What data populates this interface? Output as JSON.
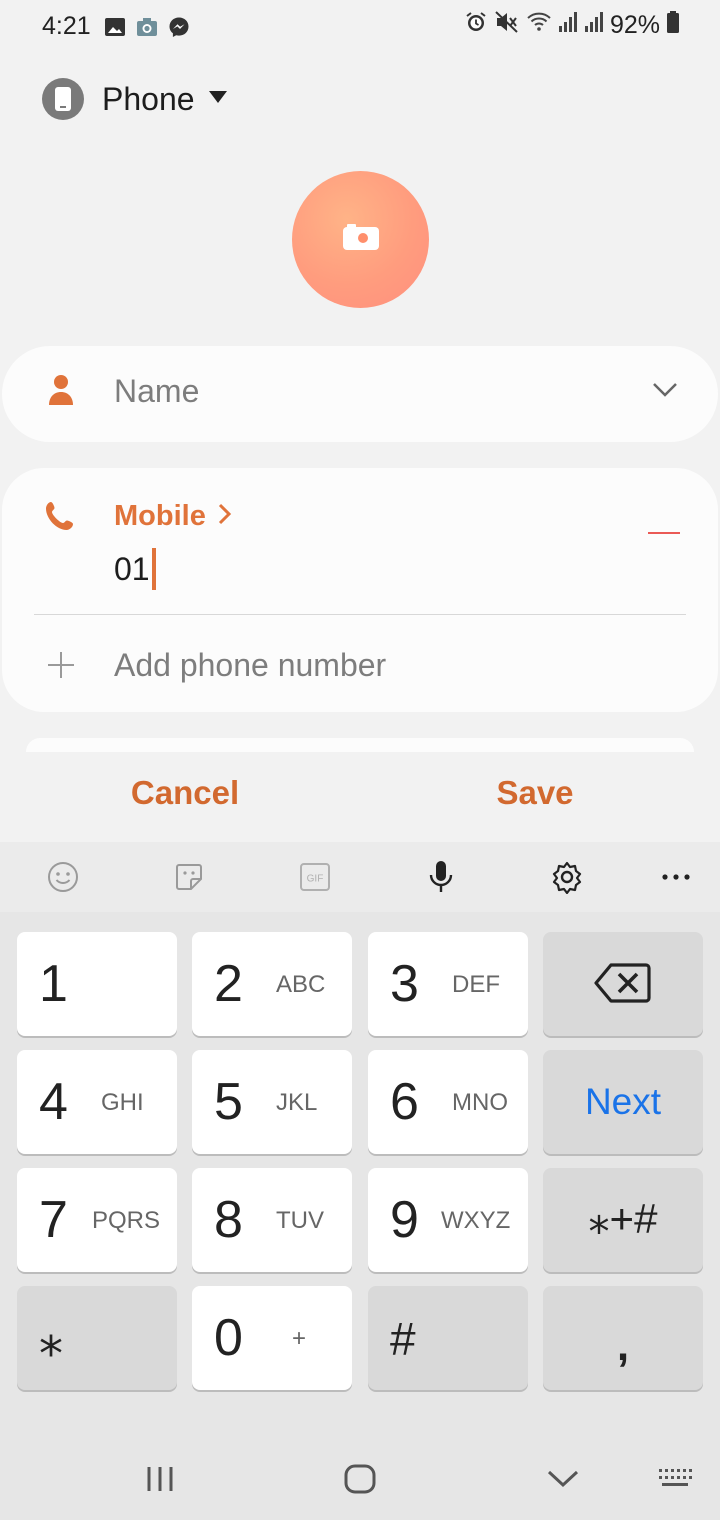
{
  "status_bar": {
    "time": "4:21",
    "battery": "92%",
    "left_icons": [
      "gallery-icon",
      "camera-icon",
      "messenger-icon"
    ],
    "right_icons": [
      "alarm-icon",
      "mute-icon",
      "wifi-icon",
      "signal-icon",
      "signal-icon",
      "battery-icon"
    ]
  },
  "account": {
    "label": "Phone"
  },
  "form": {
    "name_placeholder": "Name",
    "phone_type": "Mobile",
    "phone_value": "01",
    "add_phone_label": "Add phone number"
  },
  "actions": {
    "cancel": "Cancel",
    "save": "Save"
  },
  "keyboard": {
    "toolbar": [
      "emoji-icon",
      "sticker-icon",
      "gif-icon",
      "microphone-icon",
      "settings-icon",
      "more-icon"
    ],
    "gif_label": "GIF",
    "keys": [
      {
        "digit": "1",
        "letters": ""
      },
      {
        "digit": "2",
        "letters": "ABC"
      },
      {
        "digit": "3",
        "letters": "DEF"
      },
      {
        "digit": "4",
        "letters": "GHI"
      },
      {
        "digit": "5",
        "letters": "JKL"
      },
      {
        "digit": "6",
        "letters": "MNO"
      },
      {
        "digit": "7",
        "letters": "PQRS"
      },
      {
        "digit": "8",
        "letters": "TUV"
      },
      {
        "digit": "9",
        "letters": "WXYZ"
      },
      {
        "digit": "0",
        "letters": "+"
      }
    ],
    "next_label": "Next",
    "symbols_label": "⁎+#",
    "star_label": "⁎",
    "hash_label": "#",
    "comma_label": ",",
    "accent": "#1a73e8"
  },
  "colors": {
    "accent": "#e0733a",
    "remove": "#ea5a56"
  },
  "nav_bar": [
    "recents-icon",
    "home-icon",
    "back-icon",
    "keyboard-switch-icon"
  ]
}
